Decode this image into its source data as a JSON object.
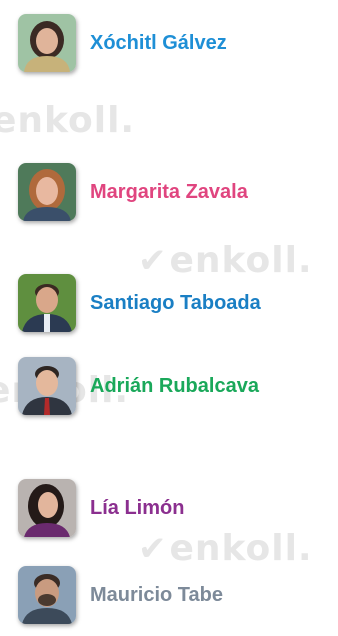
{
  "watermark": {
    "text": "enkoll."
  },
  "candidates": [
    {
      "name": "Xóchitl Gálvez",
      "color": "#1e8fd6",
      "bg": "#9fc3a4",
      "skin": "#e0b49a",
      "hair": "#3b2a24",
      "shirt": "#c7b27a"
    },
    {
      "name": "Margarita Zavala",
      "color": "#e0457f",
      "bg": "#4f7a5a",
      "skin": "#e8b8a0",
      "hair": "#b06a3c",
      "shirt": "#3a4f6a"
    },
    {
      "name": "Santiago Taboada",
      "color": "#1a7fc4",
      "bg": "#5f8f3f",
      "skin": "#d9a78a",
      "hair": "#3a2a22",
      "shirt": "#2b3a52"
    },
    {
      "name": "Adrián Rubalcava",
      "color": "#1aa85a",
      "bg": "#a7b4c2",
      "skin": "#e4b89c",
      "hair": "#2e2622",
      "shirt": "#2f3540"
    },
    {
      "name": "Lía Limón",
      "color": "#8b2f8f",
      "bg": "#b9b3b0",
      "skin": "#e2b59c",
      "hair": "#241a18",
      "shirt": "#6a2a6e"
    },
    {
      "name": "Mauricio Tabe",
      "color": "#7d8a99",
      "bg": "#8aa0b6",
      "skin": "#c99b80",
      "hair": "#3a2c26",
      "shirt": "#3c4a5a"
    }
  ]
}
